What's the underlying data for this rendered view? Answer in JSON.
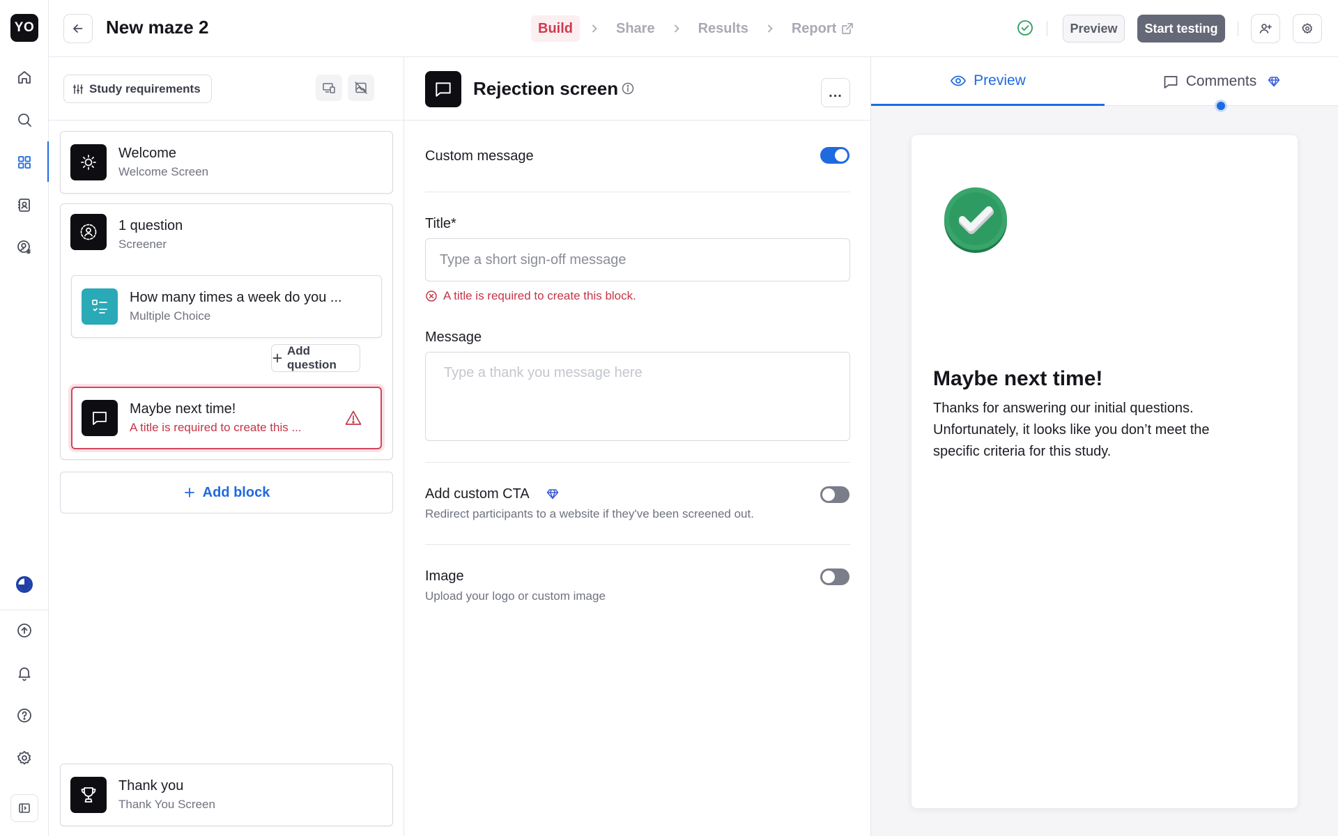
{
  "rail": {
    "logo": "YO",
    "items": [
      {
        "icon": "home-icon"
      },
      {
        "icon": "search-icon"
      },
      {
        "icon": "grid-icon",
        "active": true
      },
      {
        "icon": "contacts-icon"
      },
      {
        "icon": "user-dollar-icon"
      }
    ],
    "bottom": [
      {
        "icon": "progress-icon"
      },
      {
        "icon": "upload-icon"
      },
      {
        "icon": "bell-icon"
      },
      {
        "icon": "help-icon"
      },
      {
        "icon": "gear-icon"
      },
      {
        "icon": "expand-sidebar-icon"
      }
    ]
  },
  "header": {
    "title": "New maze 2",
    "steps": [
      {
        "label": "Build",
        "current": true
      },
      {
        "label": "Share"
      },
      {
        "label": "Results"
      },
      {
        "label": "Report"
      }
    ],
    "preview_label": "Preview",
    "start_label": "Start testing"
  },
  "blocks": {
    "requirements_label": "Study requirements",
    "welcome": {
      "title": "Welcome",
      "subtitle": "Welcome Screen"
    },
    "screener": {
      "title": "1 question",
      "subtitle": "Screener"
    },
    "question": {
      "title": "How many times a week do you ...",
      "subtitle": "Multiple Choice"
    },
    "add_question_label": "Add question",
    "rejection": {
      "title": "Maybe next time!",
      "subtitle": "A title is required to create this ..."
    },
    "add_block_label": "Add block",
    "thankyou": {
      "title": "Thank you",
      "subtitle": "Thank You Screen"
    }
  },
  "editor": {
    "title": "Rejection screen",
    "more_label": "...",
    "custom_message_label": "Custom message",
    "custom_message_on": true,
    "title_label": "Title*",
    "title_value": "",
    "title_placeholder": "Type a short sign-off message",
    "title_error": "A title is required to create this block.",
    "message_label": "Message",
    "message_placeholder": "Type a thank you message here",
    "cta_label": "Add custom CTA",
    "cta_desc": "Redirect participants to a website if they've been screened out.",
    "cta_on": false,
    "image_label": "Image",
    "image_desc": "Upload your logo or custom image",
    "image_on": false
  },
  "preview": {
    "tabs": [
      {
        "label": "Preview",
        "icon": "eye-icon",
        "active": true
      },
      {
        "label": "Comments",
        "icon": "comment-icon"
      }
    ],
    "title": "Maybe next time!",
    "message": "Thanks for answering our initial questions. Unfortunately, it looks like you don’t meet the specific criteria for this study."
  },
  "colors": {
    "accent": "#1e6ae0",
    "error": "#c53448",
    "success": "#2e9c62",
    "build_step": "#d13a4d"
  }
}
